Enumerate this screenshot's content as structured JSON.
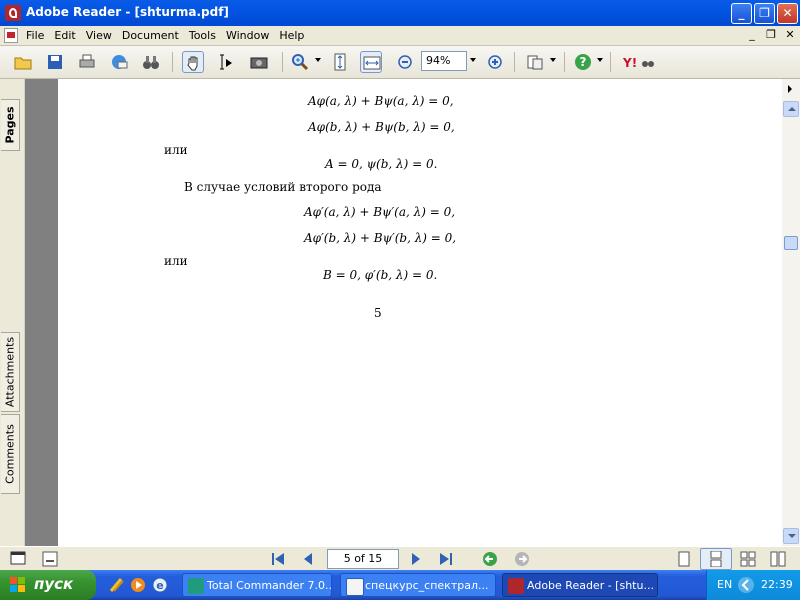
{
  "window": {
    "title": "Adobe Reader - [shturma.pdf]",
    "min": "_",
    "restore": "❐",
    "close": "✕",
    "mdi_min": "_",
    "mdi_restore": "❐",
    "mdi_close": "✕"
  },
  "menu": [
    "File",
    "Edit",
    "View",
    "Document",
    "Tools",
    "Window",
    "Help"
  ],
  "toolbar": {
    "zoom": "94%"
  },
  "nav_tabs": {
    "pages": "Pages",
    "attachments": "Attachments",
    "comments": "Comments"
  },
  "document": {
    "lines": [
      {
        "text": "Aφ(a, λ) + Bψ(a, λ) = 0,",
        "kind": "eq"
      },
      {
        "text": "Aφ(b, λ) + Bψ(b, λ) = 0,",
        "kind": "eq"
      },
      {
        "text": "или",
        "kind": "text"
      },
      {
        "text": "A = 0, ψ(b, λ) = 0.",
        "kind": "eq"
      },
      {
        "text": "В случае условий второго рода",
        "kind": "text"
      },
      {
        "text": "Aφ′(a, λ) + Bψ′(a, λ) = 0,",
        "kind": "eq"
      },
      {
        "text": "Aφ′(b, λ) + Bψ′(b, λ) = 0,",
        "kind": "eq"
      },
      {
        "text": "или",
        "kind": "text"
      },
      {
        "text": "B = 0, φ′(b, λ) = 0.",
        "kind": "eq"
      },
      {
        "text": "5",
        "kind": "text"
      }
    ]
  },
  "status": {
    "page_indicator": "5 of 15"
  },
  "taskbar": {
    "start": "пуск",
    "tasks": [
      {
        "label": "Total Commander 7.0..."
      },
      {
        "label": "спецкурс_спектрал..."
      },
      {
        "label": "Adobe Reader - [shtu..."
      }
    ],
    "lang": "EN",
    "clock": "22:39"
  }
}
